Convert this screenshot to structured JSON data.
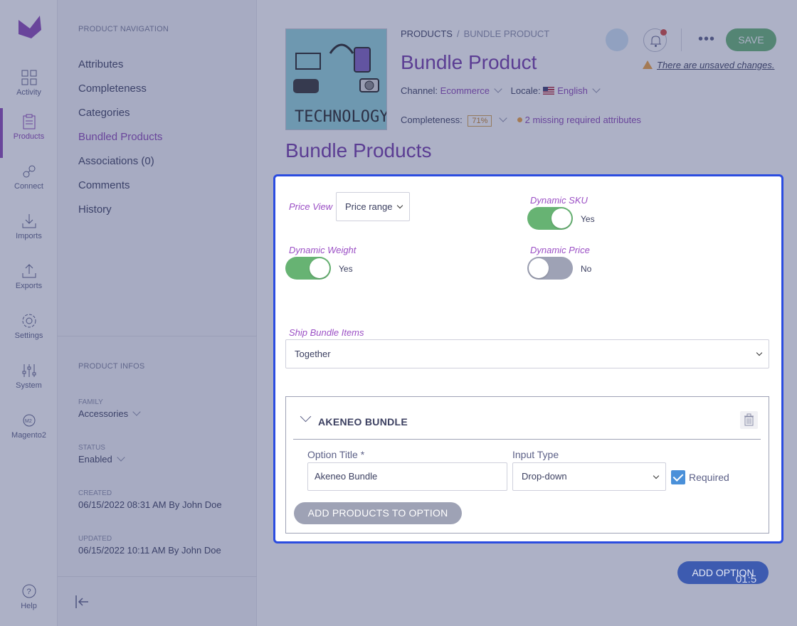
{
  "nav": {
    "items": [
      {
        "label": "Activity",
        "icon": "activity-icon"
      },
      {
        "label": "Products",
        "icon": "products-icon"
      },
      {
        "label": "Connect",
        "icon": "connect-icon"
      },
      {
        "label": "Imports",
        "icon": "imports-icon"
      },
      {
        "label": "Exports",
        "icon": "exports-icon"
      },
      {
        "label": "Settings",
        "icon": "settings-icon"
      },
      {
        "label": "System",
        "icon": "system-icon"
      },
      {
        "label": "Magento2",
        "icon": "magento2-icon"
      }
    ],
    "help": "Help",
    "active": "Products"
  },
  "subnav": {
    "title": "PRODUCT NAVIGATION",
    "links": [
      "Attributes",
      "Completeness",
      "Categories",
      "Bundled Products",
      "Associations (0)",
      "Comments",
      "History"
    ],
    "active": "Bundled Products",
    "infos_title": "PRODUCT INFOS",
    "family_label": "FAMILY",
    "family_value": "Accessories",
    "status_label": "STATUS",
    "status_value": "Enabled",
    "created_label": "CREATED",
    "created_value": "06/15/2022 08:31 AM By John Doe",
    "updated_label": "UPDATED",
    "updated_value": "06/15/2022 10:11 AM By John Doe"
  },
  "header": {
    "breadcrumb_root": "PRODUCTS",
    "breadcrumb_sep": "/",
    "breadcrumb_current": "BUNDLE PRODUCT",
    "title": "Bundle Product",
    "channel_label": "Channel:",
    "channel_value": "Ecommerce",
    "locale_label": "Locale:",
    "locale_value": "English",
    "completeness_label": "Completeness:",
    "completeness_value": "71%",
    "missing": "2 missing required attributes",
    "unsaved": "There are unsaved changes.",
    "save": "SAVE",
    "more": "•••",
    "image_caption": "TECHNOLOGY"
  },
  "section": {
    "title": "Bundle Products"
  },
  "panel": {
    "price_view_label": "Price View",
    "price_view_value": "Price range",
    "dynamic_sku_label": "Dynamic SKU",
    "dynamic_sku_value": "Yes",
    "dynamic_sku_on": true,
    "dynamic_weight_label": "Dynamic Weight",
    "dynamic_weight_value": "Yes",
    "dynamic_weight_on": true,
    "dynamic_price_label": "Dynamic Price",
    "dynamic_price_value": "No",
    "dynamic_price_on": false,
    "ship_label": "Ship Bundle Items",
    "ship_value": "Together",
    "bundle": {
      "title": "AKENEO BUNDLE",
      "option_title_label": "Option Title *",
      "option_title_value": "Akeneo Bundle",
      "input_type_label": "Input Type",
      "input_type_value": "Drop-down",
      "required_label": "Required",
      "required_checked": true,
      "add_products": "ADD PRODUCTS TO OPTION"
    }
  },
  "footer": {
    "add_option": "ADD OPTION",
    "timer": "01:5"
  },
  "colors": {
    "accent": "#7238a8",
    "toggle_on": "#67b373",
    "panel_border": "#2b4ce0"
  }
}
